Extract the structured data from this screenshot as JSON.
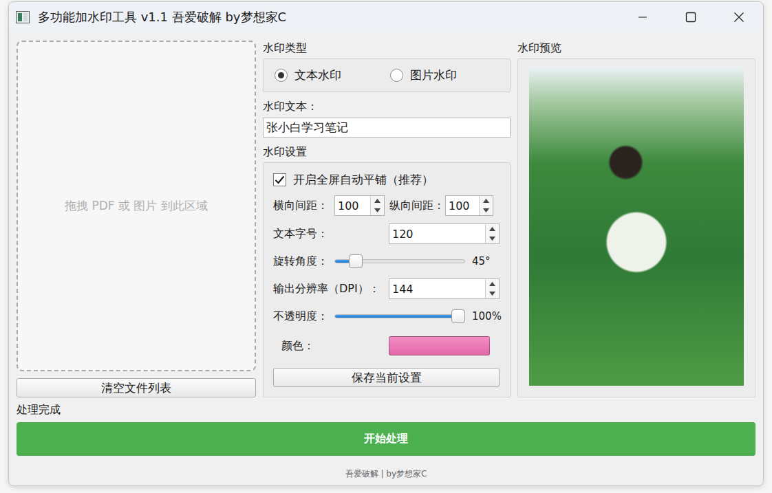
{
  "window": {
    "title": "多功能加水印工具 v1.1 吾爱破解 by梦想家C"
  },
  "drop_zone": {
    "placeholder": "拖拽 PDF 或 图片 到此区域"
  },
  "clear_button": "清空文件列表",
  "watermark_type": {
    "label": "水印类型",
    "options": [
      {
        "label": "文本水印",
        "selected": true
      },
      {
        "label": "图片水印",
        "selected": false
      }
    ]
  },
  "watermark_text": {
    "label": "水印文本：",
    "value": "张小白学习笔记"
  },
  "settings": {
    "label": "水印设置",
    "rows": [
      {
        "kind": "checkbox",
        "label": "开启全屏自动平铺（推荐）",
        "checked": true
      },
      {
        "kind": "spinpair",
        "fields": [
          {
            "label": "横向间距：",
            "value": "100"
          },
          {
            "label": "纵向间距：",
            "value": "100"
          }
        ]
      },
      {
        "kind": "spin",
        "label": "文本字号：",
        "value": "120"
      },
      {
        "kind": "slider",
        "label": "旋转角度：",
        "level": 0.125,
        "reading": "45°"
      },
      {
        "kind": "spin",
        "label": "输出分辨率（DPI）：",
        "value": "144"
      },
      {
        "kind": "slider",
        "label": "不透明度：",
        "level": 1,
        "reading": "100%"
      },
      {
        "kind": "color",
        "label": "颜色：",
        "color": "#f06db3"
      }
    ],
    "save_button": "保存当前设置"
  },
  "preview": {
    "label": "水印预览"
  },
  "status": "处理完成",
  "start_button": "开始处理",
  "footer": "吾爱破解 | by梦想家C"
}
